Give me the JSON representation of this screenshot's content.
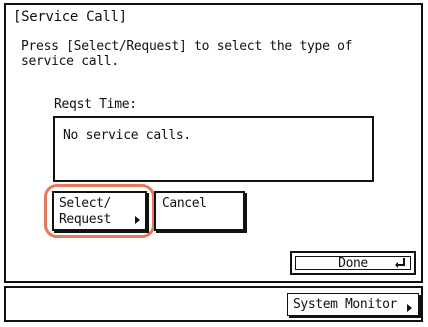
{
  "dialog": {
    "title": "[Service Call]",
    "message": "Press [Select/Request] to select the type of\nservice call.",
    "reqst_time_label": "Reqst Time:",
    "list_text": "No service calls."
  },
  "buttons": {
    "select_line1": "Select/",
    "select_line2": "Request",
    "cancel": "Cancel",
    "done": "Done"
  },
  "status_bar": {
    "system_monitor": "System Monitor"
  },
  "colors": {
    "highlight": "#e8785a"
  },
  "icons": {
    "done": "enter-return-icon",
    "select": "triangle-right-icon",
    "system_monitor": "triangle-right-icon"
  }
}
